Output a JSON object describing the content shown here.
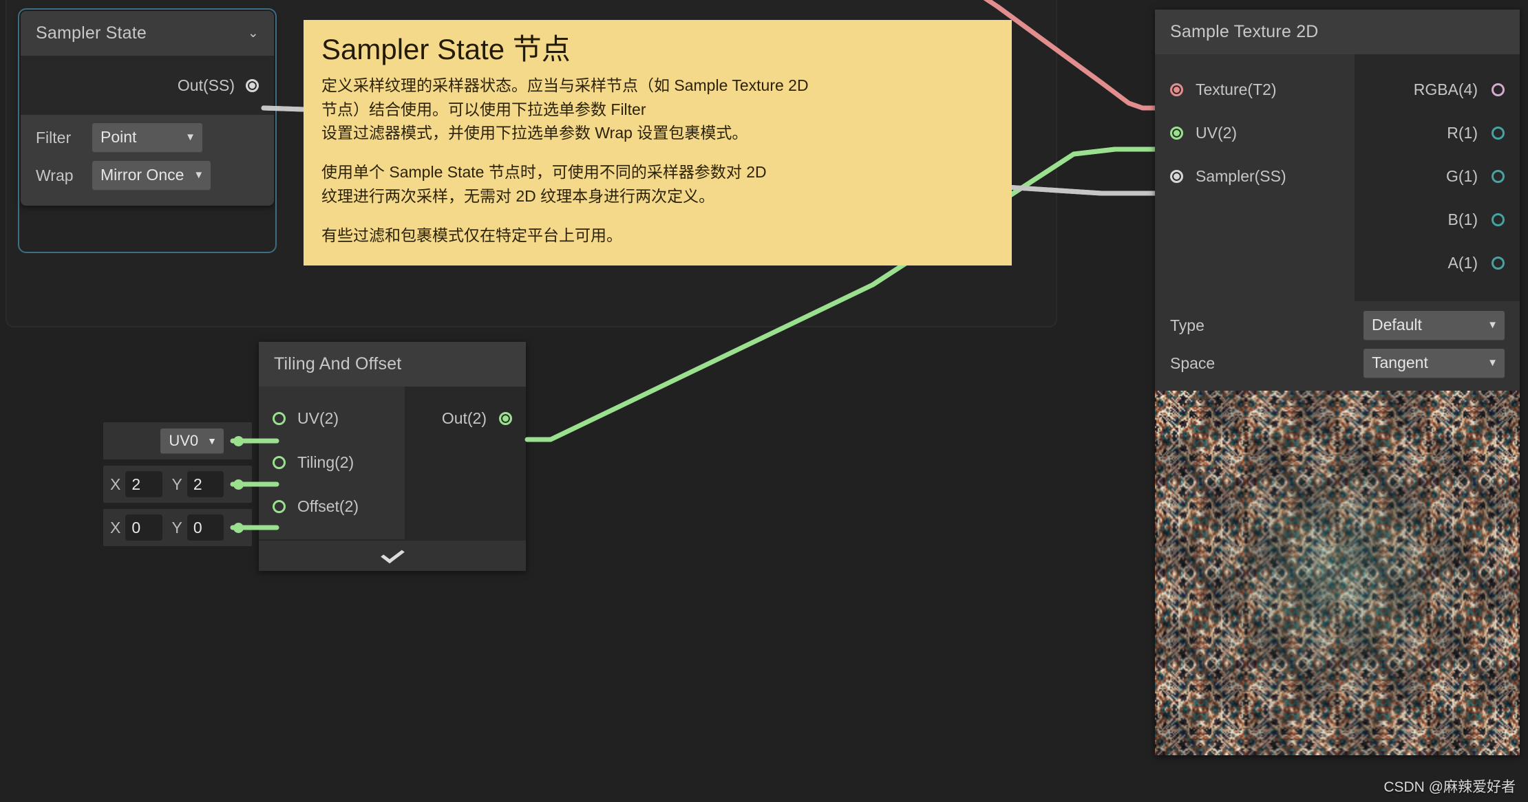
{
  "canvas": {
    "background_color": "#212121",
    "group_border_color": "#2b2b2b",
    "selection_color": "#3e6d86"
  },
  "watermark": {
    "text": "CSDN @麻辣爱好者"
  },
  "sampler_state_node": {
    "title": "Sampler State",
    "collapse_caret": "⌄",
    "selected": true,
    "outputs": [
      {
        "label": "Out(SS)",
        "port_style": "filled-white"
      }
    ],
    "controls": [
      {
        "label": "Filter",
        "value": "Point",
        "arrow": "▼"
      },
      {
        "label": "Wrap",
        "value": "Mirror Once",
        "arrow": "▼"
      }
    ]
  },
  "tooltip": {
    "title": "Sampler State 节点",
    "paragraphs": [
      "定义采样纹理的采样器状态。应当与采样节点（如 Sample Texture 2D\n节点）结合使用。可以使用下拉选单参数 Filter\n设置过滤器模式，并使用下拉选单参数 Wrap 设置包裹模式。",
      "使用单个 Sample State 节点时，可使用不同的采样器参数对 2D\n纹理进行两次采样，无需对 2D 纹理本身进行两次定义。",
      "有些过滤和包裹模式仅在特定平台上可用。"
    ],
    "background_color": "#f5d98a",
    "text_color": "#2b2208"
  },
  "sample_texture_2d_node": {
    "title": "Sample Texture 2D",
    "inputs": [
      {
        "label": "Texture(T2)",
        "port_style": "filled-red",
        "connected": true
      },
      {
        "label": "UV(2)",
        "port_style": "filled-green",
        "connected": true
      },
      {
        "label": "Sampler(SS)",
        "port_style": "filled-white",
        "connected": true
      }
    ],
    "outputs": [
      {
        "label": "RGBA(4)",
        "port_style": "empty-pink",
        "connected": false
      },
      {
        "label": "R(1)",
        "port_style": "empty-teal",
        "connected": false
      },
      {
        "label": "G(1)",
        "port_style": "empty-teal",
        "connected": false
      },
      {
        "label": "B(1)",
        "port_style": "empty-teal",
        "connected": false
      },
      {
        "label": "A(1)",
        "port_style": "empty-teal",
        "connected": false
      }
    ],
    "controls": [
      {
        "label": "Type",
        "value": "Default",
        "arrow": "▼"
      },
      {
        "label": "Space",
        "value": "Tangent",
        "arrow": "▼"
      }
    ],
    "preview": {
      "name": "texture-preview",
      "description": "tiled mirrored texture preview"
    }
  },
  "tiling_and_offset_node": {
    "title": "Tiling And Offset",
    "inputs": [
      {
        "label": "UV(2)",
        "port_style": "empty-green",
        "connected": true
      },
      {
        "label": "Tiling(2)",
        "port_style": "empty-green",
        "connected": true
      },
      {
        "label": "Offset(2)",
        "port_style": "empty-green",
        "connected": true
      }
    ],
    "outputs": [
      {
        "label": "Out(2)",
        "port_style": "filled-green",
        "connected": true
      }
    ],
    "footer_caret": "⌄",
    "input_slots": [
      {
        "type": "dropdown",
        "value": "UV0",
        "arrow": "▼"
      },
      {
        "type": "vector2",
        "x_label": "X",
        "x_value": "2",
        "y_label": "Y",
        "y_value": "2"
      },
      {
        "type": "vector2",
        "x_label": "X",
        "x_value": "0",
        "y_label": "Y",
        "y_value": "0"
      }
    ]
  },
  "wires": [
    {
      "name": "sampler-to-sample-texture",
      "color": "#c6c6c6",
      "from": "Out(SS)",
      "to": "Sampler(SS)"
    },
    {
      "name": "tiling-out-to-uv",
      "color": "#9ae08f",
      "from": "Out(2)",
      "to": "UV(2)"
    },
    {
      "name": "texture-input-wire",
      "color": "#e38e8e",
      "from": "offscreen",
      "to": "Texture(T2)"
    },
    {
      "name": "uv0-to-uv-input",
      "color": "#9ae08f",
      "from": "UV0",
      "to": "UV(2)"
    },
    {
      "name": "tiling-vec-to-tiling-input",
      "color": "#9ae08f",
      "from": "Tiling vector",
      "to": "Tiling(2)"
    },
    {
      "name": "offset-vec-to-offset-input",
      "color": "#9ae08f",
      "from": "Offset vector",
      "to": "Offset(2)"
    }
  ]
}
